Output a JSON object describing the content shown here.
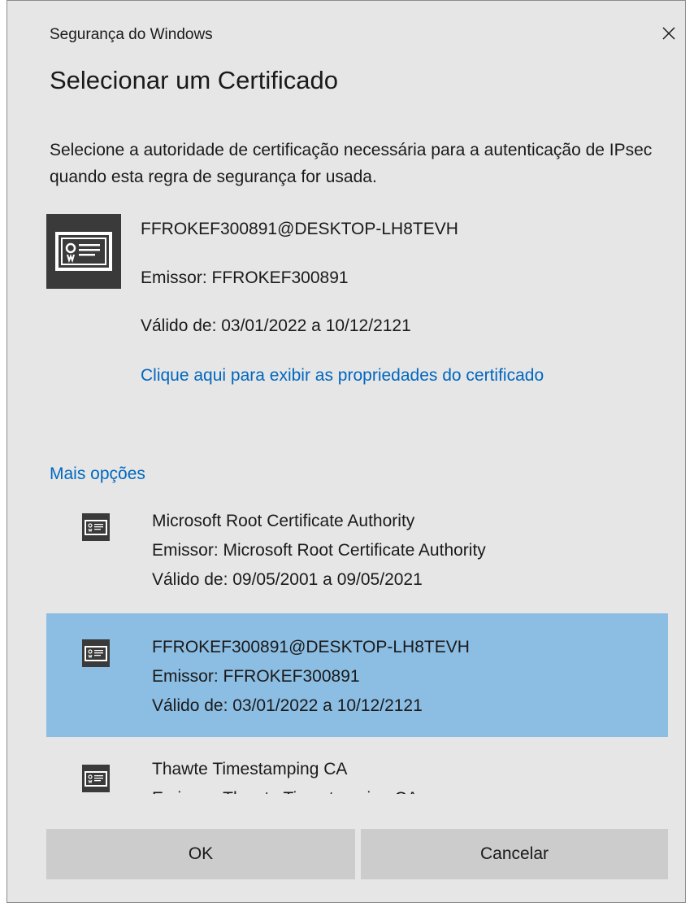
{
  "window": {
    "title": "Segurança do Windows",
    "close_icon": "close-icon"
  },
  "dialog": {
    "heading": "Selecionar um Certificado",
    "description": "Selecione a autoridade de certificação necessária para a autenticação de IPsec quando esta regra de segurança for usada."
  },
  "selected_certificate": {
    "icon": "certificate-icon",
    "name": "FFROKEF300891@DESKTOP-LH8TEVH",
    "issuer": "Emissor: FFROKEF300891",
    "valid": "Válido de: 03/01/2022 a 10/12/2121",
    "properties_link": "Clique aqui para exibir as propriedades do certificado"
  },
  "more_options": {
    "label": "Mais opções",
    "items": [
      {
        "name": "Microsoft Root Certificate Authority",
        "issuer": "Emissor: Microsoft Root Certificate Authority",
        "valid": "Válido de: 09/05/2001 a 09/05/2021",
        "selected": false
      },
      {
        "name": "FFROKEF300891@DESKTOP-LH8TEVH",
        "issuer": "Emissor: FFROKEF300891",
        "valid": "Válido de: 03/01/2022 a 10/12/2121",
        "selected": true
      },
      {
        "name": "Thawte Timestamping CA",
        "issuer": "Emissor: Thawte Timestamping CA",
        "valid": "",
        "selected": false
      }
    ]
  },
  "buttons": {
    "ok": "OK",
    "cancel": "Cancelar"
  },
  "colors": {
    "dialog_bg": "#e6e6e6",
    "link": "#0067c0",
    "selected_row": "#8cbde3",
    "button_bg": "#cccccc",
    "icon_dark": "#3a3a3a"
  }
}
